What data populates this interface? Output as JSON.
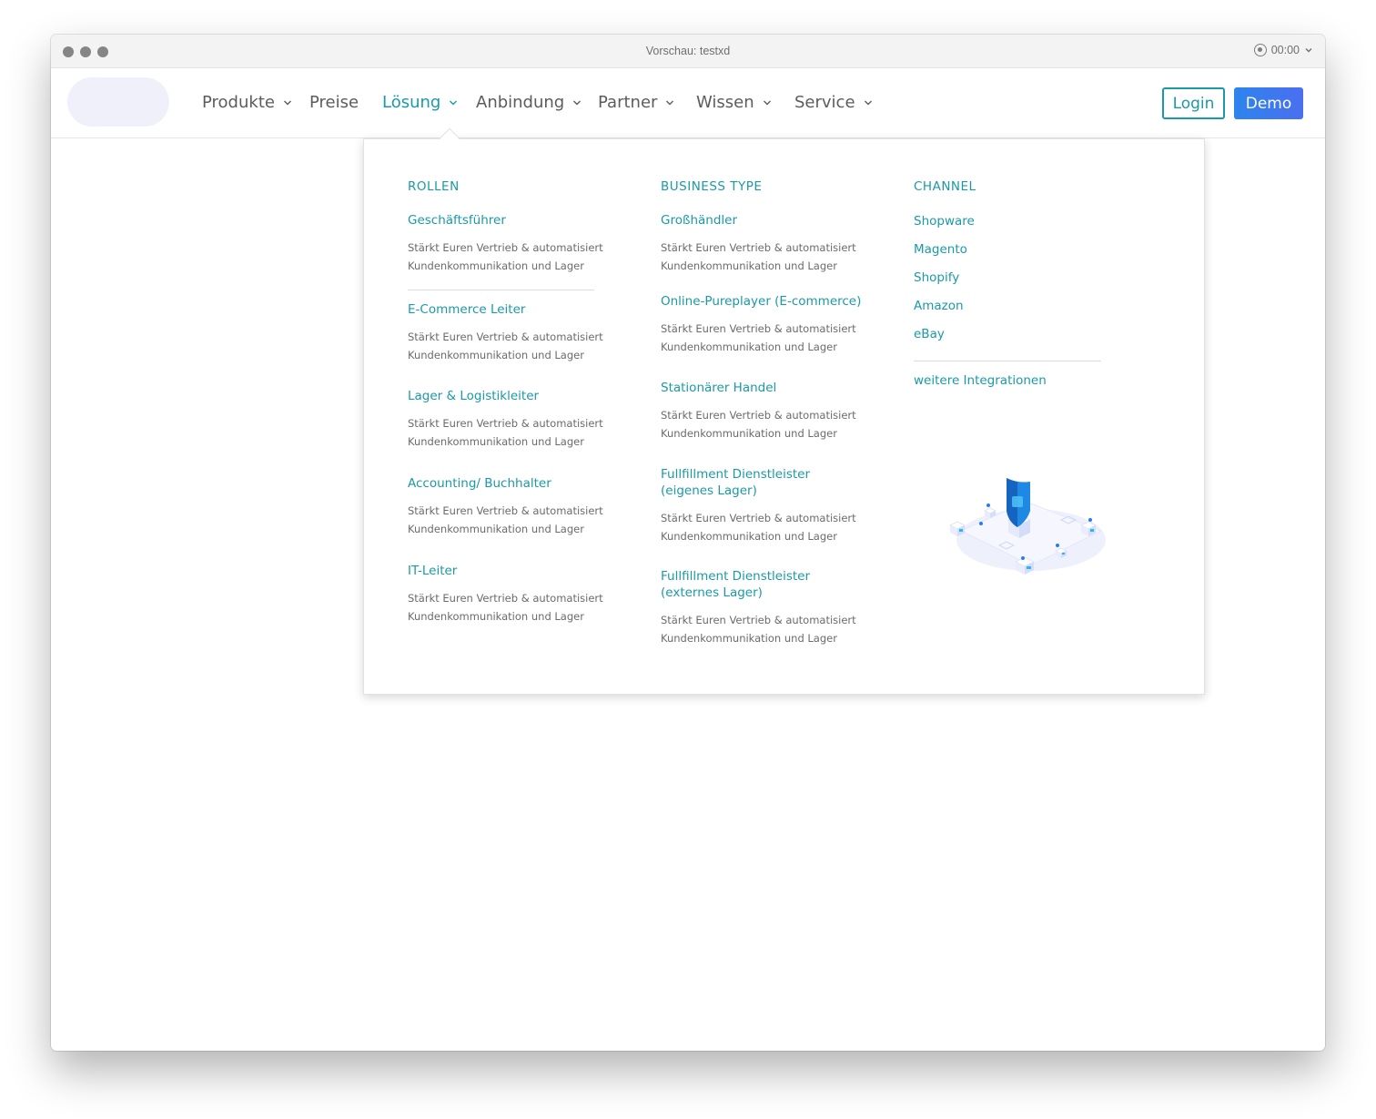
{
  "window": {
    "title": "Vorschau: testxd",
    "timer": "00:00"
  },
  "nav": {
    "items": [
      {
        "label": "Produkte",
        "has_dropdown": true
      },
      {
        "label": "Preise",
        "has_dropdown": false
      },
      {
        "label": "Lösung",
        "has_dropdown": true,
        "active": true
      },
      {
        "label": "Anbindung",
        "has_dropdown": true
      },
      {
        "label": "Partner",
        "has_dropdown": true
      },
      {
        "label": "Wissen",
        "has_dropdown": true
      },
      {
        "label": "Service",
        "has_dropdown": true
      }
    ],
    "login_label": "Login",
    "demo_label": "Demo"
  },
  "menu": {
    "rollen": {
      "heading": "ROLLEN",
      "items": [
        {
          "title": "Geschäftsführer",
          "desc_1": "Stärkt Euren Vertrieb & automatisiert",
          "desc_2": "Kundenkommunikation und Lager"
        },
        {
          "title": "E-Commerce Leiter",
          "desc_1": "Stärkt Euren Vertrieb & automatisiert",
          "desc_2": "Kundenkommunikation und Lager"
        },
        {
          "title": "Lager & Logistikleiter",
          "desc_1": "Stärkt Euren Vertrieb & automatisiert",
          "desc_2": "Kundenkommunikation und Lager"
        },
        {
          "title": "Accounting/ Buchhalter",
          "desc_1": "Stärkt Euren Vertrieb & automatisiert",
          "desc_2": "Kundenkommunikation und Lager"
        },
        {
          "title": "IT-Leiter",
          "desc_1": "Stärkt Euren Vertrieb & automatisiert",
          "desc_2": "Kundenkommunikation und Lager"
        }
      ]
    },
    "business": {
      "heading": "BUSINESS TYPE",
      "items": [
        {
          "title": "Großhändler",
          "title_2": "",
          "desc_1": "Stärkt Euren Vertrieb & automatisiert",
          "desc_2": "Kundenkommunikation und Lager"
        },
        {
          "title": "Online-Pureplayer (E-commerce)",
          "title_2": "",
          "desc_1": "Stärkt Euren Vertrieb & automatisiert",
          "desc_2": "Kundenkommunikation und Lager"
        },
        {
          "title": "Stationärer Handel",
          "title_2": "",
          "desc_1": "Stärkt Euren Vertrieb & automatisiert",
          "desc_2": "Kundenkommunikation und Lager"
        },
        {
          "title": "Fullfillment Dienstleister",
          "title_2": "(eigenes Lager)",
          "desc_1": "Stärkt Euren Vertrieb & automatisiert",
          "desc_2": "Kundenkommunikation und Lager"
        },
        {
          "title": "Fullfillment Dienstleister",
          "title_2": "(externes Lager)",
          "desc_1": "Stärkt Euren Vertrieb & automatisiert",
          "desc_2": "Kundenkommunikation und Lager"
        }
      ]
    },
    "channel": {
      "heading": "CHANNEL",
      "items": [
        "Shopware",
        "Magento",
        "Shopify",
        "Amazon",
        "eBay"
      ],
      "more_label": "weitere Integrationen"
    }
  },
  "colors": {
    "accent": "#1a9aa6",
    "demo_gradient_start": "#2d84ee",
    "demo_gradient_end": "#4a6fef",
    "nav_text": "#5c5c5c"
  },
  "icons": {
    "traffic_lights": "traffic-light-icon",
    "record": "record-icon",
    "chevron": "chevron-down-icon",
    "illustration": "security-shield-illustration"
  }
}
